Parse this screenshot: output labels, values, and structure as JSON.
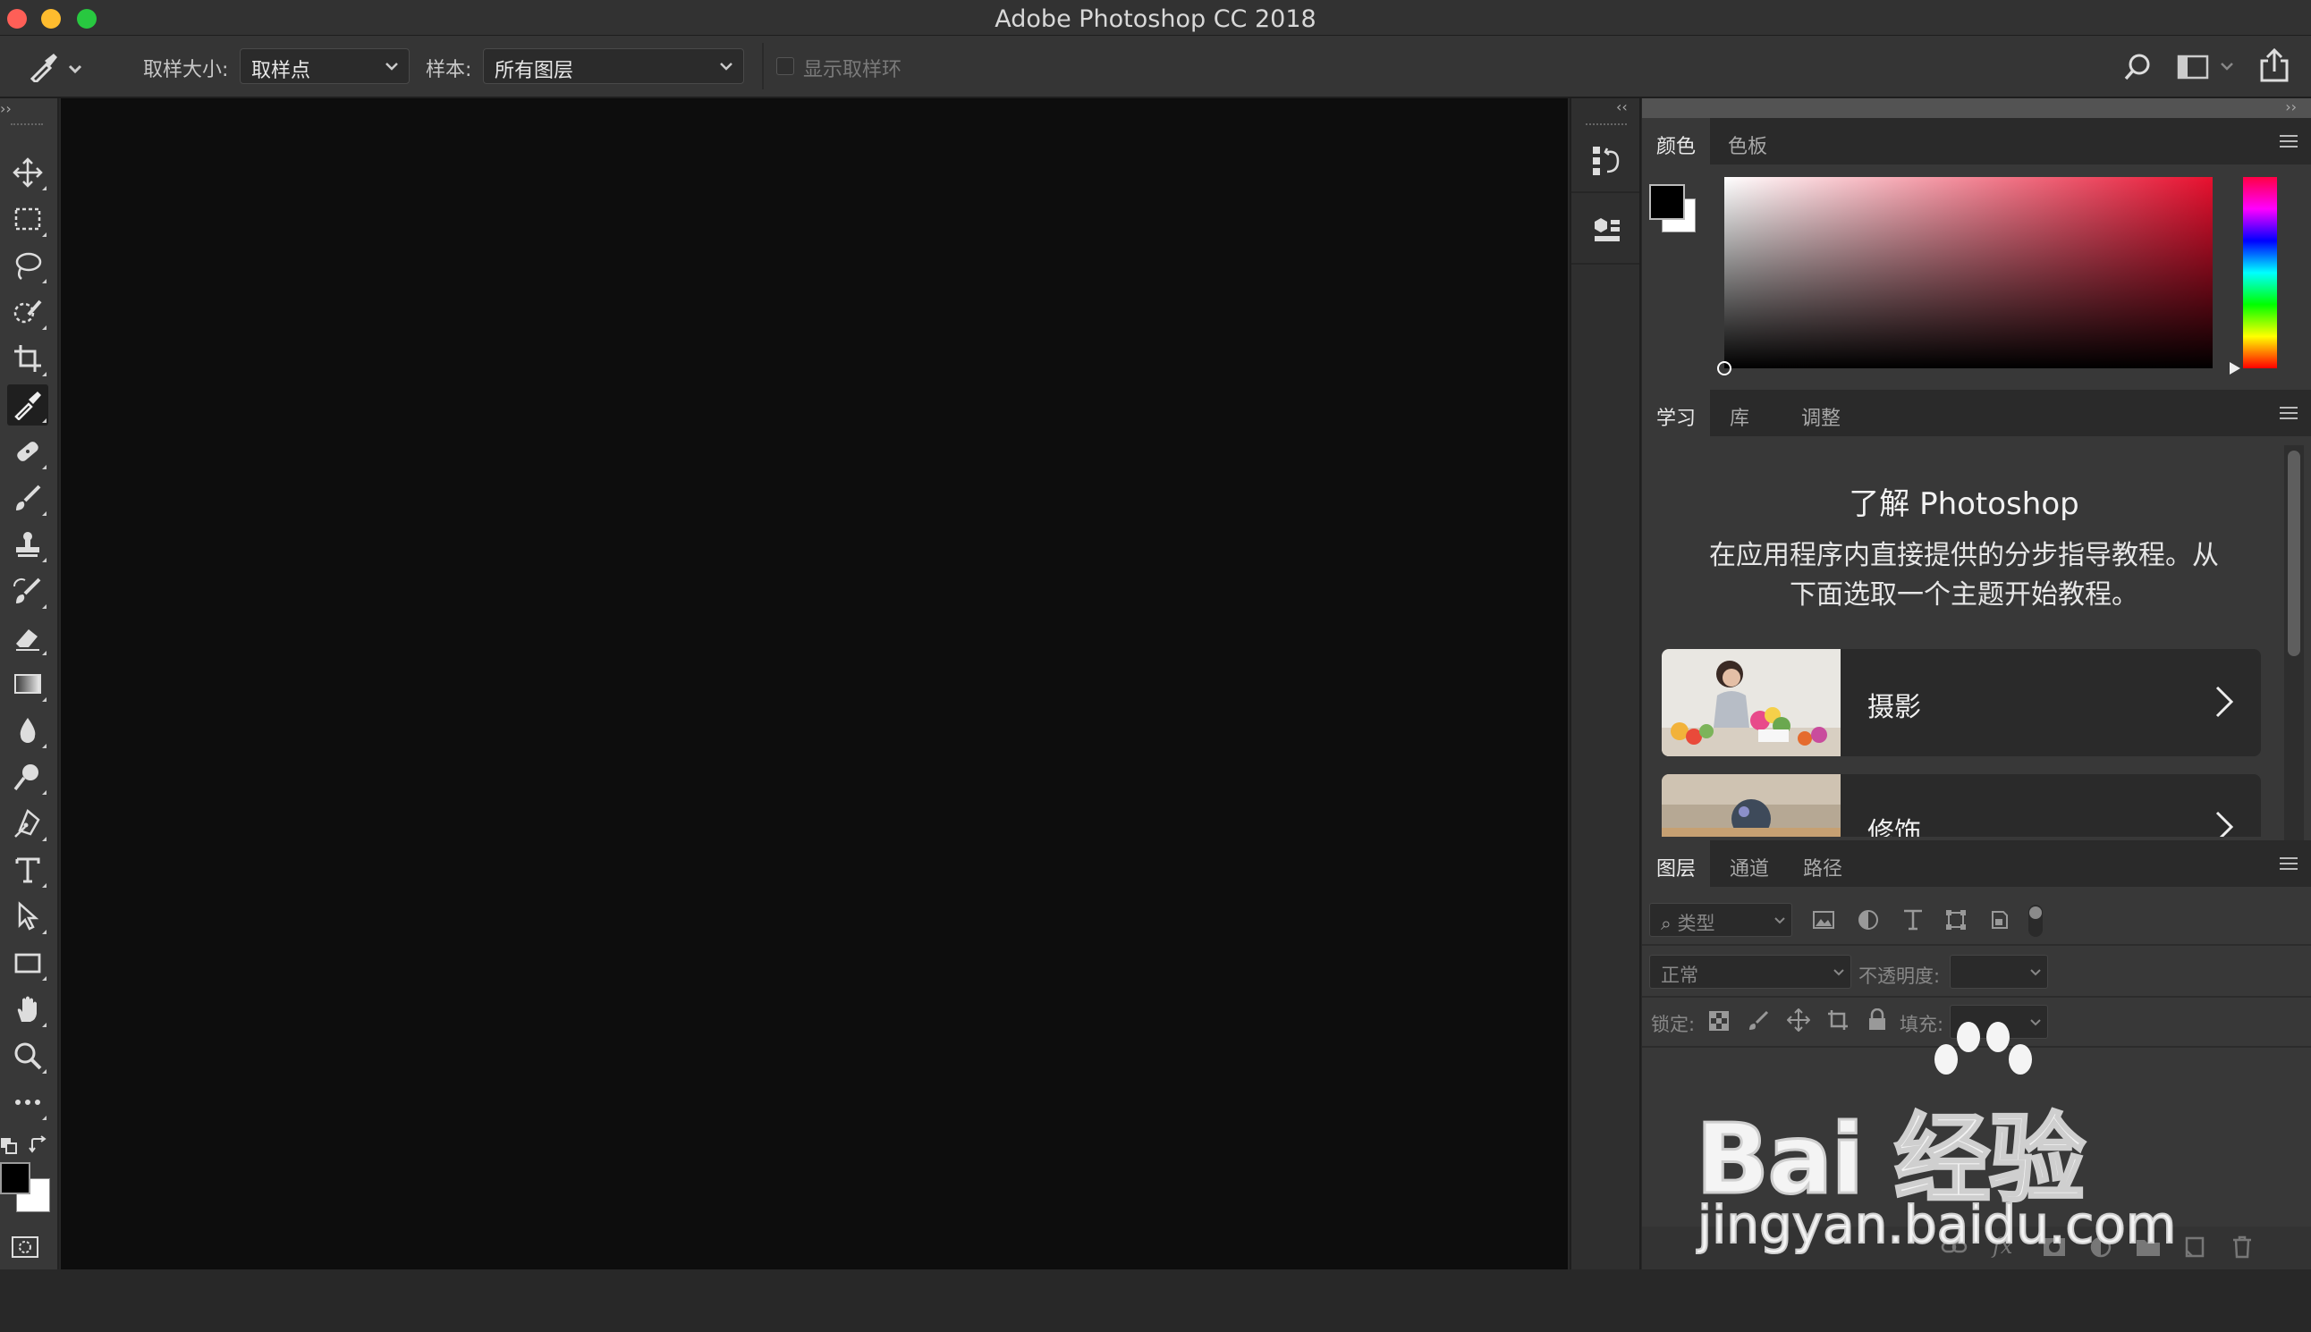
{
  "window": {
    "title": "Adobe Photoshop CC 2018",
    "traffic_lights": {
      "close": "#fe5f57",
      "minimize": "#febc2e",
      "zoom": "#28c840"
    }
  },
  "options_bar": {
    "tool_icon": "eyedropper-icon",
    "sample_size_label": "取样大小:",
    "sample_size_value": "取样点",
    "sample_label": "样本:",
    "sample_value": "所有图层",
    "show_ring_label": "显示取样环",
    "right_icons": [
      "search-icon",
      "workspace-icon",
      "share-icon"
    ]
  },
  "toolbar": {
    "active_tool": "eyedropper",
    "tools": [
      "move",
      "marquee",
      "lasso",
      "quick-selection",
      "crop",
      "eyedropper",
      "healing",
      "brush",
      "stamp",
      "history-brush",
      "eraser",
      "gradient",
      "blur",
      "dodge",
      "pen",
      "type",
      "path-selection",
      "rectangle",
      "hand",
      "zoom",
      "more"
    ],
    "foreground_color": "#000000",
    "background_color": "#ffffff"
  },
  "color_panel": {
    "tabs": [
      "颜色",
      "色板"
    ],
    "active_tab": "颜色",
    "hue": "#e8102f"
  },
  "learn_panel": {
    "tabs": [
      "学习",
      "库",
      "调整"
    ],
    "active_tab": "学习",
    "heading": "了解 Photoshop",
    "description_line1": "在应用程序内直接提供的分步指导教程。从",
    "description_line2": "下面选取一个主题开始教程。",
    "cards": [
      {
        "label": "摄影"
      },
      {
        "label": "修饰"
      }
    ]
  },
  "layers_panel": {
    "tabs": [
      "图层",
      "通道",
      "路径"
    ],
    "active_tab": "图层",
    "filter_kind": "类型",
    "blend_mode": "正常",
    "opacity_label": "不透明度:",
    "lock_label": "锁定:",
    "fill_label": "填充:",
    "footer_icons": [
      "link-icon",
      "fx-icon",
      "mask-icon",
      "adjustment-icon",
      "folder-icon",
      "new-layer-icon",
      "trash-icon"
    ],
    "fx_text": "fx"
  },
  "watermark": {
    "text_top": "Bai 经验",
    "text_bottom": "jingyan.baidu.com"
  }
}
